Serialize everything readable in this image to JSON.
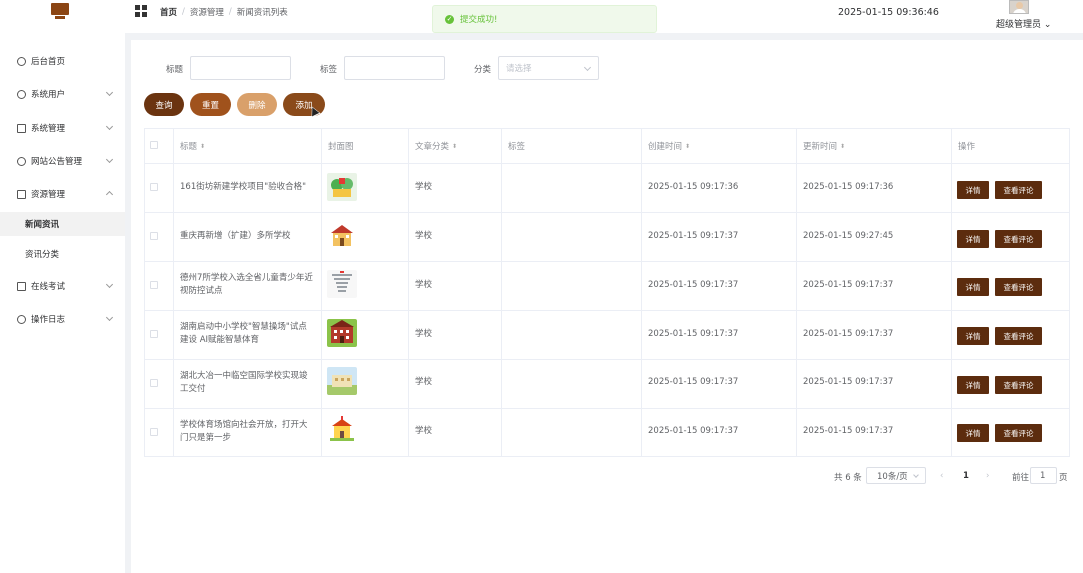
{
  "header": {
    "breadcrumb": [
      "首页",
      "资源管理",
      "新闻资讯列表"
    ],
    "toast": "提交成功!",
    "datetime": "2025-01-15 09:36:46",
    "user": "超级管理员"
  },
  "sidebar": {
    "items": [
      {
        "label": "后台首页",
        "icon": "clock-icon"
      },
      {
        "label": "系统用户",
        "icon": "user-icon"
      },
      {
        "label": "系统管理",
        "icon": "inbox-icon"
      },
      {
        "label": "网站公告管理",
        "icon": "sun-icon"
      },
      {
        "label": "资源管理",
        "icon": "box-icon"
      },
      {
        "label": "在线考试",
        "icon": "box-icon"
      },
      {
        "label": "操作日志",
        "icon": "user-icon"
      }
    ],
    "sub_items": [
      {
        "label": "新闻资讯",
        "active": true
      },
      {
        "label": "资讯分类",
        "active": false
      }
    ]
  },
  "filters": {
    "title_label": "标题",
    "tag_label": "标签",
    "category_label": "分类",
    "category_placeholder": "请选择"
  },
  "actions": {
    "query": "查询",
    "reset": "重置",
    "delete": "删除",
    "add": "添加"
  },
  "table": {
    "columns": [
      "标题",
      "封面图",
      "文章分类",
      "标签",
      "创建时间",
      "更新时间",
      "操作"
    ],
    "rows": [
      {
        "title": "161街坊新建学校项目\"验收合格\"",
        "category": "学校",
        "tag": "",
        "created": "2025-01-15 09:17:36",
        "updated": "2025-01-15 09:17:36"
      },
      {
        "title": "重庆再新增（扩建）多所学校",
        "category": "学校",
        "tag": "",
        "created": "2025-01-15 09:17:37",
        "updated": "2025-01-15 09:27:45"
      },
      {
        "title": "德州7所学校入选全省儿童青少年近视防控试点",
        "category": "学校",
        "tag": "",
        "created": "2025-01-15 09:17:37",
        "updated": "2025-01-15 09:17:37"
      },
      {
        "title": "湖南启动中小学校\"智慧操场\"试点建设 AI赋能智慧体育",
        "category": "学校",
        "tag": "",
        "created": "2025-01-15 09:17:37",
        "updated": "2025-01-15 09:17:37"
      },
      {
        "title": "湖北大冶一中临空国际学校实现竣工交付",
        "category": "学校",
        "tag": "",
        "created": "2025-01-15 09:17:37",
        "updated": "2025-01-15 09:17:37"
      },
      {
        "title": "学校体育场馆向社会开放，打开大门只是第一步",
        "category": "学校",
        "tag": "",
        "created": "2025-01-15 09:17:37",
        "updated": "2025-01-15 09:17:37"
      }
    ],
    "detail_label": "详情",
    "comment_label": "查看评论"
  },
  "pagination": {
    "total": "共 6 条",
    "page_size": "10条/页",
    "current": "1",
    "goto_prefix": "前往",
    "goto_value": "1",
    "goto_suffix": "页"
  },
  "colors": {
    "accent_dark": "#5c2c0e",
    "accent_mid": "#a0521c",
    "accent_light": "#d9a06a",
    "success": "#67c23a"
  }
}
